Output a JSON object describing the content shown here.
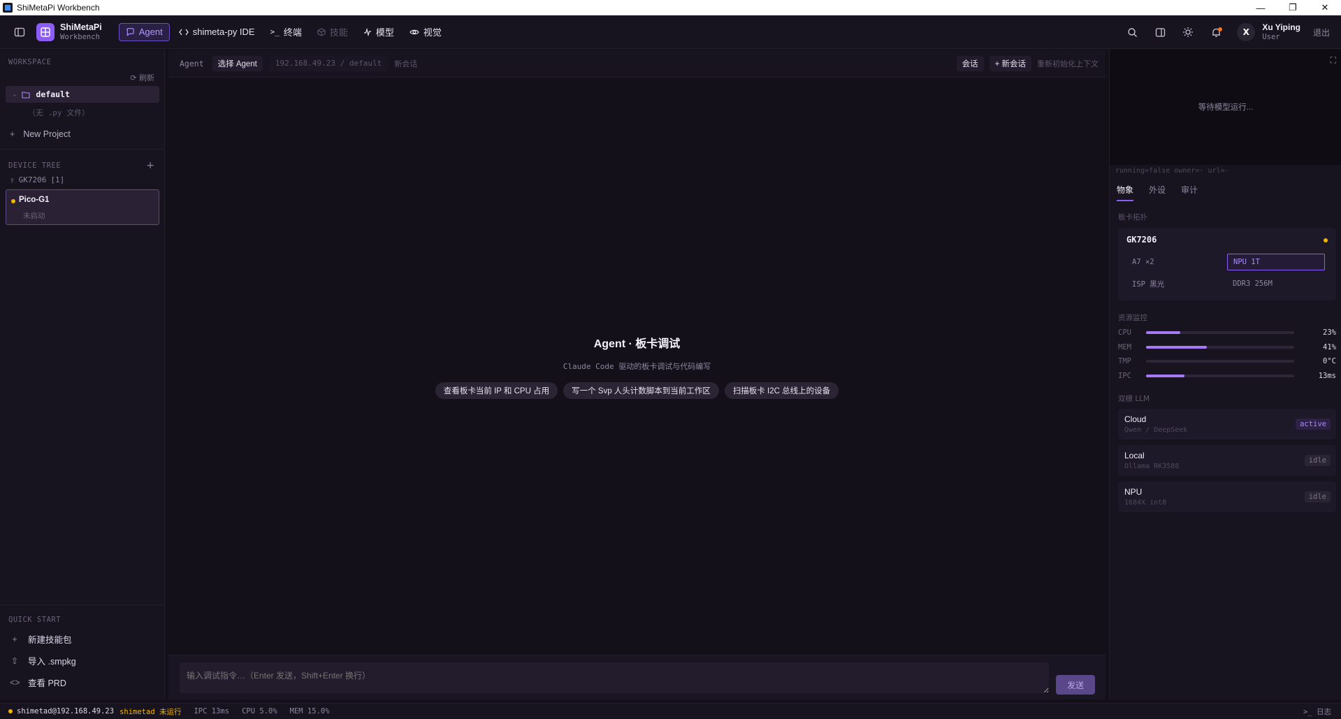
{
  "window": {
    "title": "ShiMetaPi Workbench",
    "controls": {
      "minimize": "—",
      "maximize": "❐",
      "close": "✕"
    }
  },
  "topbar": {
    "brand": "ShiMetaPi",
    "brand_sub": "Workbench",
    "nav": [
      {
        "label": "Agent",
        "icon": "chat-bubble-icon",
        "state": "active"
      },
      {
        "label": "shimeta-py IDE",
        "icon": "code-brackets-icon",
        "state": "normal"
      },
      {
        "label": "终端",
        "icon": "terminal-icon",
        "state": "normal"
      },
      {
        "label": "技能",
        "icon": "cube-icon",
        "state": "disabled"
      },
      {
        "label": "模型",
        "icon": "activity-icon",
        "state": "normal"
      },
      {
        "label": "视觉",
        "icon": "eye-icon",
        "state": "normal"
      }
    ],
    "user": {
      "initial": "X",
      "name": "Xu Yiping",
      "role": "User"
    },
    "logout": "退出"
  },
  "sidebar": {
    "workspace_title": "WORKSPACE",
    "refresh": "刷新",
    "workspace_item": "default",
    "workspace_empty": "（无 .py 文件）",
    "new_project": "New Project",
    "device_tree_title": "DEVICE TREE",
    "device_group": "GK7206",
    "device_group_count": "[1]",
    "device": {
      "name": "Pico-G1",
      "status": "未启动"
    },
    "quick_start_title": "QUICK START",
    "quick_start": [
      {
        "label": "新建技能包",
        "icon": "plus-icon"
      },
      {
        "label": "导入 .smpkg",
        "icon": "upload-icon"
      },
      {
        "label": "查看 PRD",
        "icon": "code-brackets-icon"
      }
    ]
  },
  "main": {
    "context": {
      "agent_label": "Agent",
      "select_agent": "选择 Agent",
      "path": "192.168.49.23 / default",
      "new_session": "新会话",
      "sessions_button": "会话",
      "new_session_button": "+ 新会话",
      "reinit": "重新初始化上下文"
    },
    "hero_title": "Agent · 板卡调试",
    "hero_subtitle": "Claude Code 驱动的板卡调试与代码编写",
    "suggestions": [
      "查看板卡当前 IP 和 CPU 占用",
      "写一个 Svp 人头计数脚本到当前工作区",
      "扫描板卡 I2C 总线上的设备"
    ],
    "input_placeholder": "输入调试指令…（Enter 发送，Shift+Enter 换行）",
    "send": "发送"
  },
  "right_panel": {
    "preview_status": "等待模型运行...",
    "run_info": "running=false owner=- url=-",
    "tabs": [
      "物象",
      "外设",
      "审计"
    ],
    "board_section": "板卡拓扑",
    "board": {
      "name": "GK7206",
      "cells": [
        "A7 ×2",
        "NPU 1T",
        "ISP 黑光",
        "DDR3 256M"
      ]
    },
    "resource_section": "资源监控",
    "resources": [
      {
        "label": "CPU",
        "value": "23%",
        "level": 0.23
      },
      {
        "label": "MEM",
        "value": "41%",
        "level": 0.41
      },
      {
        "label": "TMP",
        "value": "0°C",
        "level": 0
      },
      {
        "label": "IPC",
        "value": "13ms",
        "level": 0.26
      }
    ],
    "llm_section": "双模 LLM",
    "llm": [
      {
        "name": "Cloud",
        "sub": "Qwen / DeepSeek",
        "badge": "active"
      },
      {
        "name": "Local",
        "sub": "Ollama RK3588",
        "badge": "idle"
      },
      {
        "name": "NPU",
        "sub": "1684X int8",
        "badge": "idle"
      }
    ]
  },
  "statusbar": {
    "host": "shimetad@192.168.49.23",
    "service": "shimetad 未运行",
    "ipc": "IPC 13ms",
    "cpu": "CPU 5.0%",
    "mem": "MEM 15.0%",
    "logs": "日志"
  },
  "colors": {
    "accent": "#8b5cf6",
    "warning": "#f5b400",
    "background": "#131019",
    "panel": "#17131f"
  }
}
